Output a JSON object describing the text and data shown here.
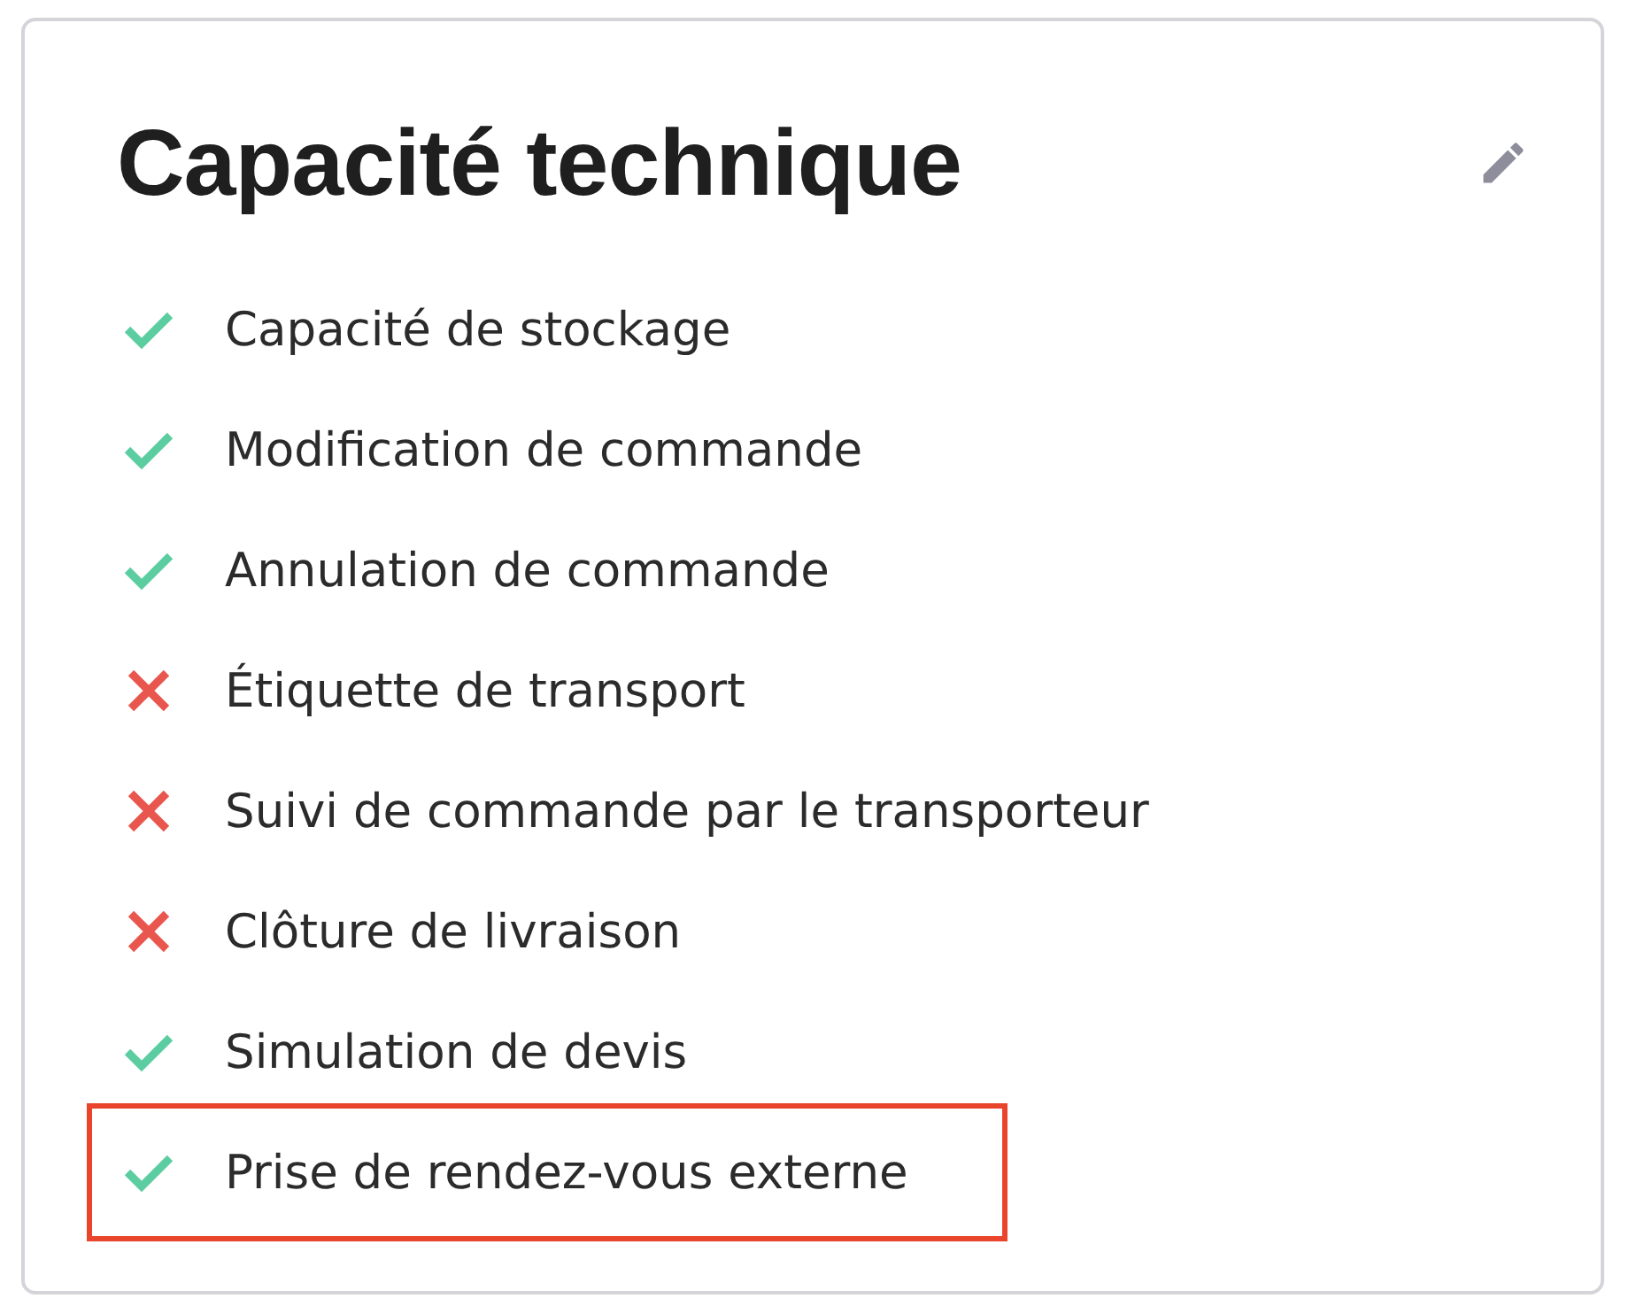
{
  "card": {
    "title": "Capacité technique",
    "items": [
      {
        "label": "Capacité de stockage",
        "available": true,
        "highlighted": false
      },
      {
        "label": "Modification de commande",
        "available": true,
        "highlighted": false
      },
      {
        "label": "Annulation de commande",
        "available": true,
        "highlighted": false
      },
      {
        "label": "Étiquette de transport",
        "available": false,
        "highlighted": false
      },
      {
        "label": "Suivi de commande par le transporteur",
        "available": false,
        "highlighted": false
      },
      {
        "label": "Clôture de livraison",
        "available": false,
        "highlighted": false
      },
      {
        "label": "Simulation de devis",
        "available": true,
        "highlighted": false
      },
      {
        "label": "Prise de rendez-vous externe",
        "available": true,
        "highlighted": true
      }
    ]
  }
}
